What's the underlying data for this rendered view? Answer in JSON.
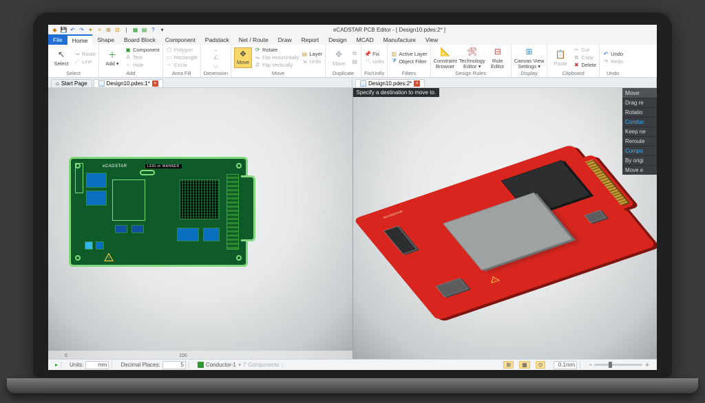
{
  "app": {
    "title": "eCADSTAR PCB Editor - [ Design10.pdes:2* ]"
  },
  "qat": [
    {
      "name": "app-icon",
      "glyph": "◆",
      "cls": "orange"
    },
    {
      "name": "save-icon",
      "glyph": "💾",
      "cls": "blue"
    },
    {
      "name": "undo-icon",
      "glyph": "↶",
      "cls": "blue"
    },
    {
      "name": "redo-icon",
      "glyph": "↷",
      "cls": "blue"
    },
    {
      "name": "snap1-icon",
      "glyph": "✦",
      "cls": "orange"
    },
    {
      "name": "snap2-icon",
      "glyph": "✧",
      "cls": "orange"
    },
    {
      "name": "snap3-icon",
      "glyph": "⊞",
      "cls": "orange"
    },
    {
      "name": "snap4-icon",
      "glyph": "⊡",
      "cls": "orange"
    },
    {
      "name": "div-icon",
      "glyph": "|",
      "cls": ""
    },
    {
      "name": "win1-icon",
      "glyph": "▦",
      "cls": "green"
    },
    {
      "name": "win2-icon",
      "glyph": "▤",
      "cls": "green"
    },
    {
      "name": "help-icon",
      "glyph": "?",
      "cls": "blue"
    },
    {
      "name": "drop-icon",
      "glyph": "▾",
      "cls": ""
    }
  ],
  "menu": {
    "file": "File",
    "tabs": [
      "Home",
      "Shape",
      "Board Block",
      "Component",
      "Padstack",
      "Net / Route",
      "Draw",
      "Report",
      "Design",
      "MCAD",
      "Manufacture",
      "View"
    ],
    "active": "Home"
  },
  "ribbon": {
    "select": {
      "label": "Select",
      "btn": "Select",
      "sub_route": "Route",
      "sub_line": "Line"
    },
    "add": {
      "label": "Add",
      "main": "Add ▾",
      "items": [
        "Component",
        "Text",
        "Hole"
      ]
    },
    "areafill": {
      "label": "Area Fill",
      "items": [
        "Polygon",
        "Rectangle",
        "Circle"
      ]
    },
    "dim": {
      "label": "Dimension"
    },
    "move": {
      "label": "Move",
      "main": "Move",
      "r1": "Rotate",
      "r2": "Flip Horizontally",
      "r3": "Flip Vertically",
      "s1": "Layer",
      "s2": "Unfix"
    },
    "dup": {
      "label": "Duplicate",
      "btn": "Move"
    },
    "fix": {
      "label": "Fix/Unfix",
      "r1": "Fix",
      "r2": "Unfix"
    },
    "filters": {
      "label": "Filters",
      "r1": "Active Layer",
      "r2": "Object Filter"
    },
    "rules": {
      "label": "Design Rules",
      "b1": "Constraint\nBrowser",
      "b2": "Technology\nEditor ▾",
      "b3": "Rule\nEditor"
    },
    "display": {
      "label": "Display",
      "b1": "Canvas View\nSettings ▾"
    },
    "clip": {
      "label": "Clipboard",
      "b1": "Paste",
      "b2": "Cut",
      "b3": "Copy",
      "b4": "Delete"
    },
    "undo": {
      "label": "Undo",
      "b1": "Undo",
      "b2": "Redo"
    }
  },
  "doctabs": {
    "left": [
      {
        "name": "start-page",
        "label": "Start Page",
        "home": true
      },
      {
        "name": "design1",
        "label": "Design10.pdes:1*",
        "close": true
      }
    ],
    "right": [
      {
        "name": "design2",
        "label": "Design10.pdes:2*",
        "close": true
      }
    ]
  },
  "board2d": {
    "brand": "eCADSTAR",
    "rev": "LERi-m  WANNER"
  },
  "board3d": {
    "brand": "eCADSTAR"
  },
  "prompt": "Specify a destination to move to.",
  "movepanel": {
    "title": "Move",
    "rows": [
      {
        "t": "Drag re"
      },
      {
        "t": "Rotatio"
      },
      {
        "t": "Conduc",
        "link": true
      },
      {
        "t": "Keep ne"
      },
      {
        "t": "Reroute"
      },
      {
        "t": "Compo",
        "link": true
      },
      {
        "t": "By origi"
      },
      {
        "t": "Move e"
      }
    ]
  },
  "ruler": {
    "t0": "0",
    "t1": "100"
  },
  "status": {
    "units_lbl": "Units:",
    "units": "mm",
    "dp_lbl": "Decimal Places:",
    "dp": "5",
    "layer": "Conductor-1",
    "layer_n": "7",
    "comp": "Components",
    "zoom": "0.1mm"
  }
}
